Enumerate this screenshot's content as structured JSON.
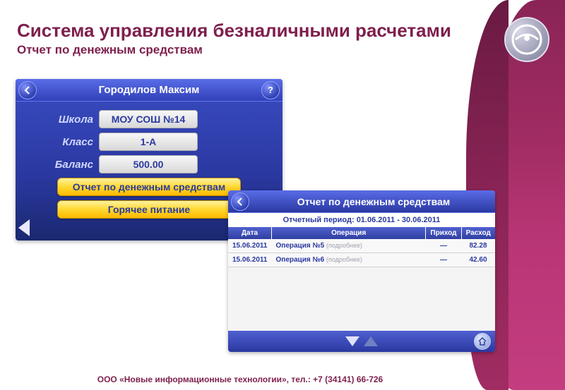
{
  "page": {
    "title_main": "Система управления безналичными расчетами",
    "title_sub": "Отчет по денежным средствам",
    "footer": "ООО «Новые информационные технологии», тел.: +7 (34141) 66-726"
  },
  "screen1": {
    "header_title": "Городилов Максим",
    "label_school": "Школа",
    "value_school": "МОУ СОШ №14",
    "label_class": "Класс",
    "value_class": "1-А",
    "label_balance": "Баланс",
    "value_balance": "500.00",
    "btn_report": "Отчет по денежным средствам",
    "btn_food": "Горячее питание",
    "help": "?"
  },
  "screen2": {
    "header_title": "Отчет по денежным средствам",
    "period": "Отчетный период: 01.06.2011 - 30.06.2011",
    "col_date": "Дата",
    "col_op": "Операция",
    "col_in": "Приход",
    "col_out": "Расход",
    "detail_label": "(подробнее)",
    "dash": "—",
    "rows": [
      {
        "date": "15.06.2011",
        "op": "Операция №5",
        "in": "—",
        "out": "82.28"
      },
      {
        "date": "15.06.2011",
        "op": "Операция №6",
        "in": "—",
        "out": "42.60"
      }
    ]
  }
}
